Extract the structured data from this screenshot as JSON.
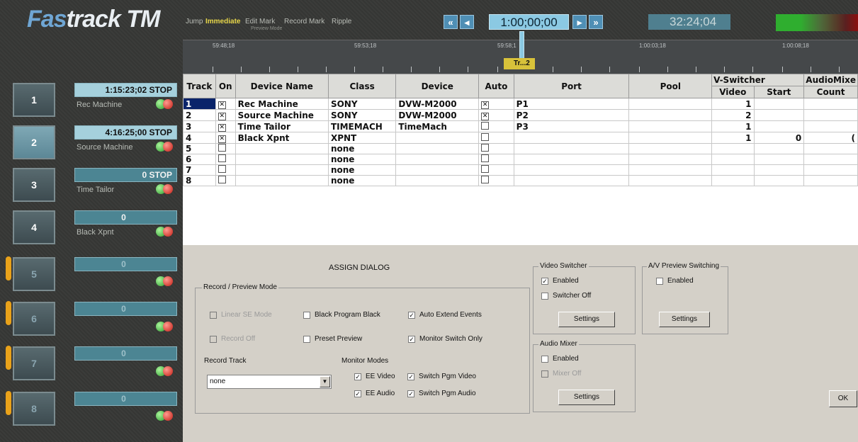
{
  "app": {
    "logo_prefix": "Fas",
    "logo_suffix": "track TM"
  },
  "toolbar": {
    "jump": "Jump",
    "immediate": "Immediate",
    "edit_mark": "Edit Mark",
    "record_mark": "Record Mark",
    "ripple": "Ripple",
    "preview_mode": "Preview Mode",
    "rewind_fast": "«",
    "rewind": "◂",
    "forward": "▸",
    "forward_fast": "»",
    "timecode": "1:00;00;00",
    "duration": "32:24;04"
  },
  "ruler": {
    "labels": [
      "59:48;18",
      "59:53;18",
      "59:58;1",
      "1:00:03;18",
      "1:00:08;18"
    ],
    "marker_label": "Tr...2"
  },
  "tracks": [
    {
      "num": "1",
      "time": "1:15:23;02 STOP",
      "name": "Rec Machine"
    },
    {
      "num": "2",
      "time": "4:16:25;00 STOP",
      "name": "Source Machine"
    },
    {
      "num": "3",
      "time": "0 STOP",
      "name": "Time Tailor"
    },
    {
      "num": "4",
      "time": "0",
      "name": "Black Xpnt"
    },
    {
      "num": "5",
      "time": "0",
      "name": ""
    },
    {
      "num": "6",
      "time": "0",
      "name": ""
    },
    {
      "num": "7",
      "time": "0",
      "name": ""
    },
    {
      "num": "8",
      "time": "0",
      "name": ""
    }
  ],
  "table": {
    "headers": {
      "track": "Track",
      "on": "On",
      "device_name": "Device Name",
      "class": "Class",
      "device": "Device",
      "auto": "Auto",
      "port": "Port",
      "pool": "Pool",
      "vswitcher": "V-Switcher",
      "audiomixer": "AudioMixe",
      "video": "Video",
      "start": "Start",
      "count": "Count"
    },
    "rows": [
      {
        "track": "1",
        "on": true,
        "device_name": "Rec Machine",
        "class": "SONY",
        "device": "DVW-M2000",
        "auto": true,
        "port": "P1",
        "pool": "",
        "video": "1",
        "start": "",
        "count": ""
      },
      {
        "track": "2",
        "on": true,
        "device_name": "Source Machine",
        "class": "SONY",
        "device": "DVW-M2000",
        "auto": true,
        "port": "P2",
        "pool": "",
        "video": "2",
        "start": "",
        "count": ""
      },
      {
        "track": "3",
        "on": true,
        "device_name": "Time Tailor",
        "class": "TIMEMACH",
        "device": "TimeMach",
        "auto": false,
        "port": "P3",
        "pool": "",
        "video": "1",
        "start": "",
        "count": ""
      },
      {
        "track": "4",
        "on": true,
        "device_name": "Black Xpnt",
        "class": "XPNT",
        "device": "",
        "auto": false,
        "port": "",
        "pool": "",
        "video": "1",
        "start": "0",
        "count": "("
      },
      {
        "track": "5",
        "on": false,
        "device_name": "",
        "class": "none",
        "device": "",
        "auto": false,
        "port": "",
        "pool": "",
        "video": "",
        "start": "",
        "count": ""
      },
      {
        "track": "6",
        "on": false,
        "device_name": "",
        "class": "none",
        "device": "",
        "auto": false,
        "port": "",
        "pool": "",
        "video": "",
        "start": "",
        "count": ""
      },
      {
        "track": "7",
        "on": false,
        "device_name": "",
        "class": "none",
        "device": "",
        "auto": false,
        "port": "",
        "pool": "",
        "video": "",
        "start": "",
        "count": ""
      },
      {
        "track": "8",
        "on": false,
        "device_name": "",
        "class": "none",
        "device": "",
        "auto": false,
        "port": "",
        "pool": "",
        "video": "",
        "start": "",
        "count": ""
      }
    ]
  },
  "dialog": {
    "title": "ASSIGN DIALOG",
    "record_preview_group": "Record / Preview Mode",
    "linear_se_mode": "Linear SE Mode",
    "black_program_black": "Black Program Black",
    "auto_extend_events": "Auto Extend Events",
    "record_off": "Record Off",
    "preset_preview": "Preset Preview",
    "monitor_switch_only": "Monitor Switch Only",
    "record_track": "Record Track",
    "record_track_value": "none",
    "monitor_modes": "Monitor Modes",
    "ee_video": "EE Video",
    "switch_pgm_video": "Switch Pgm Video",
    "ee_audio": "EE Audio",
    "switch_pgm_audio": "Switch Pgm Audio",
    "video_switcher_group": "Video Switcher",
    "vs_enabled": "Enabled",
    "vs_switcher_off": "Switcher Off",
    "vs_settings": "Settings",
    "audio_mixer_group": "Audio Mixer",
    "am_enabled": "Enabled",
    "am_mixer_off": "Mixer Off",
    "am_settings": "Settings",
    "av_preview_group": "A/V Preview Switching",
    "av_enabled": "Enabled",
    "av_settings": "Settings",
    "ok": "OK"
  }
}
